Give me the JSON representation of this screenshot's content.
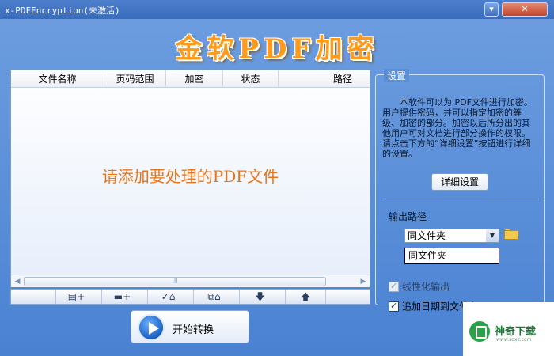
{
  "window": {
    "title": "x-PDFEncryption(未激活)",
    "minimize_glyph": "▾",
    "close_glyph": "✕"
  },
  "banner": {
    "text": "金软PDF加密"
  },
  "file_list": {
    "columns": [
      "文件名称",
      "页码范围",
      "加密",
      "状态",
      "路径"
    ],
    "hint": "请添加要处理的PDF文件",
    "scroll_grip": "III"
  },
  "toolbar": {
    "tools": [
      {
        "icon": "add-file-icon",
        "glyph": "▤+"
      },
      {
        "icon": "add-folder-icon",
        "glyph": "▬+"
      },
      {
        "icon": "remove-checked-icon",
        "glyph": "✓⌂"
      },
      {
        "icon": "remove-all-icon",
        "glyph": "⧉⌂"
      },
      {
        "icon": "move-down-icon",
        "glyph": "🡇"
      },
      {
        "icon": "move-up-icon",
        "glyph": "🡅"
      }
    ]
  },
  "start_button": {
    "label": "开始转换"
  },
  "settings": {
    "legend": "设置",
    "description": "本软件可以为 PDF文件进行加密。用户提供密码，并可以指定加密的等级、加密的部分。加密以后所分出的其他用户可对文档进行部分操作的权限。请点击下方的“详细设置”按钮进行详细的设置。",
    "detail_button": "详细设置",
    "output_label": "输出路径",
    "output_select": "同文件夹",
    "output_path": "同文件夹",
    "linearize_label": "线性化输出",
    "append_date_label": "追加日期到文件名"
  },
  "watermark": {
    "name": "神奇下载",
    "url": "www.sqxz.com"
  },
  "colors": {
    "banner": "#ff9a1a",
    "hint": "#e8741a",
    "window_bg": "#5b8fd6"
  }
}
